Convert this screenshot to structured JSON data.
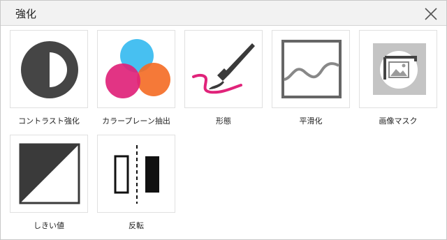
{
  "dialog": {
    "title": "強化",
    "close_icon": "close-icon"
  },
  "tools": [
    {
      "label": "コントラスト強化",
      "icon": "contrast-icon"
    },
    {
      "label": "カラープレーン抽出",
      "icon": "color-plane-icon",
      "colors": [
        "#3dbdf0",
        "#e0237a",
        "#f46a22"
      ]
    },
    {
      "label": "形態",
      "icon": "brush-icon",
      "colors": [
        "#3a3a3a",
        "#e0237a"
      ]
    },
    {
      "label": "平滑化",
      "icon": "smoothing-wave-icon"
    },
    {
      "label": "画像マスク",
      "icon": "image-mask-icon"
    },
    {
      "label": "しきい値",
      "icon": "threshold-icon"
    },
    {
      "label": "反転",
      "icon": "invert-icon"
    }
  ]
}
